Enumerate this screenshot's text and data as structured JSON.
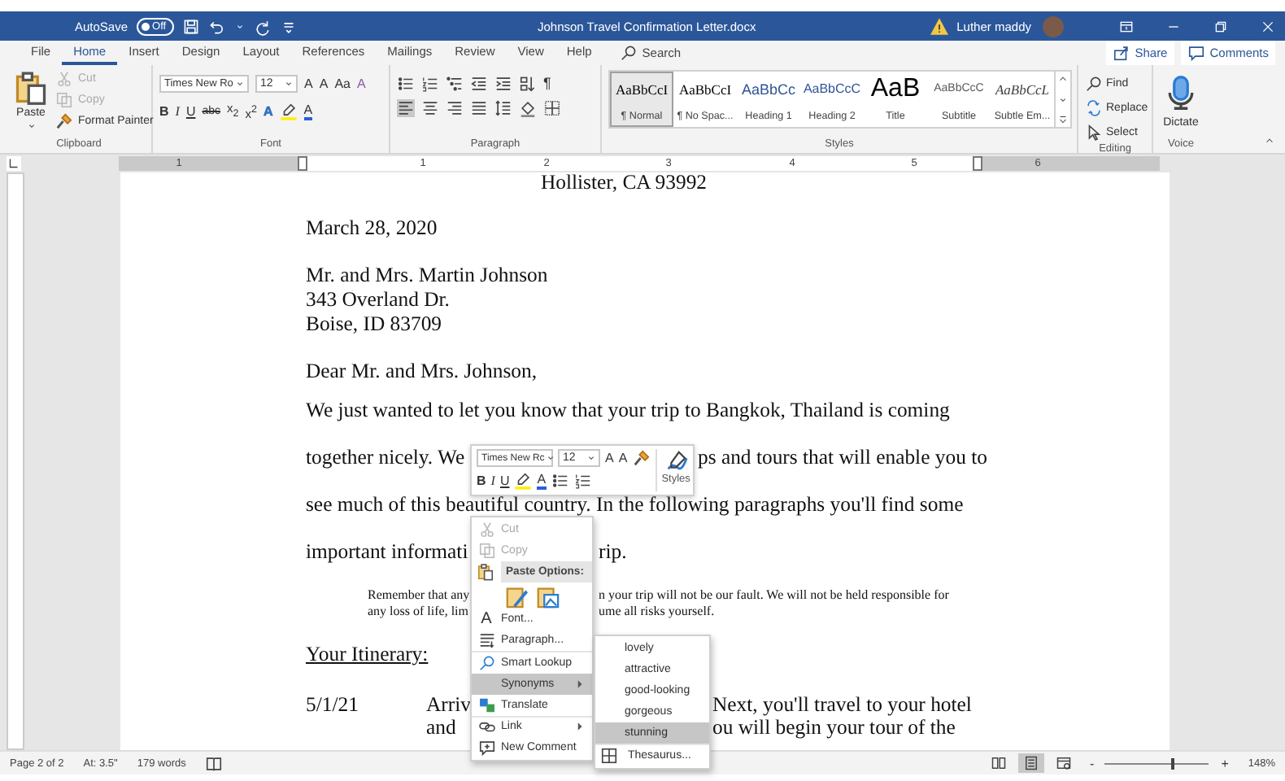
{
  "title_bar": {
    "autosave_label": "AutoSave",
    "autosave_toggle": {
      "label": "Off",
      "on": false
    },
    "title": "Johnson Travel Confirmation Letter.docx",
    "user_name": "Luther maddy"
  },
  "tabs": [
    {
      "label": "File",
      "selected": false
    },
    {
      "label": "Home",
      "selected": true
    },
    {
      "label": "Insert",
      "selected": false
    },
    {
      "label": "Design",
      "selected": false
    },
    {
      "label": "Layout",
      "selected": false
    },
    {
      "label": "References",
      "selected": false
    },
    {
      "label": "Mailings",
      "selected": false
    },
    {
      "label": "Review",
      "selected": false
    },
    {
      "label": "View",
      "selected": false
    },
    {
      "label": "Help",
      "selected": false
    }
  ],
  "search": {
    "placeholder": "Search"
  },
  "share_button": "Share",
  "comments_button": "Comments",
  "ribbon": {
    "clipboard": {
      "label": "Clipboard",
      "paste": "Paste",
      "items": [
        {
          "label": "Cut",
          "disabled": true
        },
        {
          "label": "Copy",
          "disabled": true
        },
        {
          "label": "Format Painter",
          "disabled": false
        }
      ]
    },
    "font": {
      "label": "Font",
      "name": "Times New Ro",
      "size": "12",
      "row1": [
        {
          "kind": "grow",
          "label": "A"
        },
        {
          "kind": "shrink",
          "label": "A"
        },
        {
          "kind": "case",
          "label": "Aa"
        },
        {
          "kind": "clear",
          "label": "A"
        }
      ],
      "row2": [
        {
          "kind": "bold",
          "label": "B"
        },
        {
          "kind": "italic",
          "label": "I"
        },
        {
          "kind": "underline",
          "label": "U"
        },
        {
          "kind": "strike",
          "label": "abc"
        },
        {
          "kind": "sub",
          "label": "x$_{2}$"
        },
        {
          "kind": "sup",
          "label": "x$^{2}$"
        },
        {
          "kind": "effects",
          "label": "A"
        },
        {
          "kind": "highlight"
        },
        {
          "kind": "color",
          "label": "A"
        }
      ]
    },
    "paragraph": {
      "label": "Paragraph",
      "row1": [
        {
          "kind": "bullets"
        },
        {
          "kind": "numbering"
        },
        {
          "kind": "multilevel"
        },
        {
          "kind": "outdent"
        },
        {
          "kind": "indent"
        },
        {
          "kind": "sort"
        },
        {
          "kind": "marks",
          "label": "¶"
        }
      ],
      "alignments": [
        {
          "kind": "align-left",
          "selected": true
        },
        {
          "kind": "align-center",
          "selected": false
        },
        {
          "kind": "align-right",
          "selected": false
        },
        {
          "kind": "justify",
          "selected": false
        }
      ],
      "row2": [
        {
          "kind": "spacing"
        },
        {
          "kind": "shading"
        },
        {
          "kind": "borders"
        }
      ]
    },
    "styles": {
      "label": "Styles",
      "items": [
        {
          "sample": "AaBbCcI",
          "name": "¶ Normal",
          "kind": "normal",
          "selected": true
        },
        {
          "sample": "AaBbCcI",
          "name": "¶ No Spac...",
          "kind": "normal",
          "selected": false
        },
        {
          "sample": "AaBbCc",
          "name": "Heading 1",
          "kind": "heading1",
          "selected": false
        },
        {
          "sample": "AaBbCcC",
          "name": "Heading 2",
          "kind": "heading2",
          "selected": false
        },
        {
          "sample": "AaB",
          "name": "Title",
          "kind": "title",
          "selected": false
        },
        {
          "sample": "AaBbCcC",
          "name": "Subtitle",
          "kind": "subtitle",
          "selected": false
        },
        {
          "sample": "AaBbCcL",
          "name": "Subtle Em...",
          "kind": "emphasis",
          "selected": false
        }
      ]
    },
    "editing": {
      "label": "Editing",
      "items": [
        {
          "kind": "find",
          "label": "Find"
        },
        {
          "kind": "replace",
          "label": "Replace"
        },
        {
          "kind": "select",
          "label": "Select"
        }
      ]
    },
    "voice": {
      "label": "Voice",
      "dictate": "Dictate"
    }
  },
  "ruler": [
    "1",
    "1",
    "2",
    "3",
    "4",
    "5",
    "6"
  ],
  "document": {
    "blocks": [
      {
        "kind": "center",
        "lines": [
          [
            "Hollister, CA  93992"
          ]
        ]
      },
      {
        "kind": "para",
        "lines": [
          [
            "March 28, 2020"
          ]
        ]
      },
      {
        "kind": "para",
        "lines": [
          [
            "Mr. and Mrs. Martin Johnson"
          ],
          [
            "343 Overland Dr."
          ],
          [
            "Boise, ID  83709"
          ]
        ]
      },
      {
        "kind": "para",
        "lines": [
          [
            "Dear Mr. and Mrs. Johnson,"
          ]
        ]
      },
      {
        "kind": "double",
        "lines": [
          [
            "We just wanted to let you know that your trip to Bangkok, Thailand is coming"
          ],
          [
            "together nicely.  We",
            "ps and tours that will enable you to"
          ],
          [
            "see much of this beautiful country.  In the following paragraphs you'll find some"
          ],
          [
            "important informati",
            "rip."
          ]
        ]
      },
      {
        "kind": "quote",
        "lines": [
          [
            "Remember that any",
            "n your trip will not be our fault.  We will not be held responsible for"
          ],
          [
            "any loss of life, lim",
            "ume all risks yourself."
          ]
        ]
      },
      {
        "kind": "heading",
        "lines": [
          [
            "Your Itinerary:"
          ]
        ]
      },
      {
        "kind": "itinerary",
        "lines": [
          [
            "5/1/21",
            "Arriv",
            "Next, you'll travel to your hotel"
          ],
          [
            "and",
            "ou will begin your tour of the"
          ]
        ]
      }
    ]
  },
  "mini_toolbar": {
    "font": "Times New Rc",
    "size": "12",
    "styles": "Styles",
    "row1": [
      {
        "kind": "grow",
        "label": "A"
      },
      {
        "kind": "shrink",
        "label": "A"
      },
      {
        "kind": "painter"
      }
    ],
    "row2": [
      {
        "kind": "bold",
        "label": "B"
      },
      {
        "kind": "italic",
        "label": "I"
      },
      {
        "kind": "underline",
        "label": "U"
      },
      {
        "kind": "highlight"
      },
      {
        "kind": "color",
        "label": "A"
      },
      {
        "kind": "bullets"
      },
      {
        "kind": "numbering"
      }
    ]
  },
  "context_menu": {
    "items": [
      {
        "kind": "item",
        "label": "Cut",
        "disabled": true,
        "selected": false,
        "submenu": false
      },
      {
        "kind": "item",
        "label": "Copy",
        "disabled": true,
        "selected": false,
        "submenu": false
      },
      {
        "kind": "header",
        "label": "Paste Options:"
      },
      {
        "kind": "paste-icons"
      },
      {
        "kind": "item",
        "label": "Font...",
        "glyph": "A",
        "disabled": false,
        "selected": false,
        "submenu": false
      },
      {
        "kind": "item",
        "label": "Paragraph...",
        "disabled": false,
        "selected": false,
        "submenu": false
      },
      {
        "kind": "item",
        "label": "Smart Lookup",
        "disabled": false,
        "selected": false,
        "submenu": false
      },
      {
        "kind": "item",
        "label": "Synonyms",
        "disabled": false,
        "selected": true,
        "submenu": true
      },
      {
        "kind": "item",
        "label": "Translate",
        "disabled": false,
        "selected": false,
        "submenu": false
      },
      {
        "kind": "item",
        "label": "Link",
        "disabled": false,
        "selected": false,
        "submenu": true
      },
      {
        "kind": "item",
        "label": "New Comment",
        "disabled": false,
        "selected": false,
        "submenu": false
      }
    ]
  },
  "synonyms": {
    "items": [
      {
        "label": "lovely",
        "selected": false
      },
      {
        "label": "attractive",
        "selected": false
      },
      {
        "label": "good-looking",
        "selected": false
      },
      {
        "label": "gorgeous",
        "selected": false
      },
      {
        "label": "stunning",
        "selected": true
      }
    ],
    "thesaurus": "Thesaurus..."
  },
  "status_bar": {
    "page": "Page 2 of 2",
    "position": "At: 3.5\"",
    "words": "179 words",
    "views": [
      {
        "kind": "read",
        "selected": false
      },
      {
        "kind": "print",
        "selected": true
      },
      {
        "kind": "web",
        "selected": false
      }
    ],
    "zoom": {
      "minus": "-",
      "plus": "+",
      "level": 0.65,
      "percent": "148%"
    }
  }
}
